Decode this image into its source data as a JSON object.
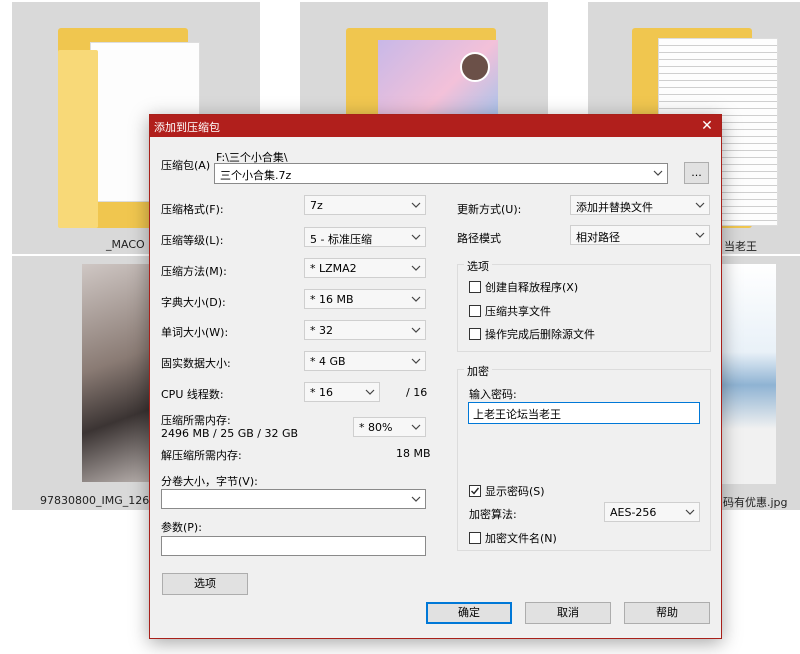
{
  "background": {
    "tiles": [
      {
        "label": "_MACO"
      },
      {
        "label": ""
      },
      {
        "label": "当老王"
      },
      {
        "label": "97830800_IMG_1265"
      },
      {
        "label": "码有优惠.jpg"
      }
    ]
  },
  "dialog": {
    "title": "添加到压缩包",
    "close_glyph": "✕",
    "archive": {
      "label": "压缩包(A)",
      "path": "F:\\三个小合集\\",
      "value": "三个小合集.7z",
      "browse_label": "..."
    },
    "left": {
      "format": {
        "label": "压缩格式(F):",
        "value": "7z"
      },
      "level": {
        "label": "压缩等级(L):",
        "value": "5 - 标准压缩"
      },
      "method": {
        "label": "压缩方法(M):",
        "value": "* LZMA2"
      },
      "dict": {
        "label": "字典大小(D):",
        "value": "* 16 MB"
      },
      "word": {
        "label": "单词大小(W):",
        "value": "* 32"
      },
      "solid": {
        "label": "固实数据大小:",
        "value": "* 4 GB"
      },
      "threads": {
        "label": "CPU 线程数:",
        "value": "* 16",
        "max": "/ 16"
      },
      "mem_compress": {
        "label": "压缩所需内存:",
        "detail": "2496 MB / 25 GB / 32 GB",
        "percent": "* 80%"
      },
      "mem_decompress": {
        "label": "解压缩所需内存:",
        "value": "18 MB"
      },
      "volume": {
        "label": "分卷大小，字节(V):",
        "value": ""
      },
      "params": {
        "label": "参数(P):",
        "value": ""
      },
      "options_button": "选项"
    },
    "right": {
      "update": {
        "label": "更新方式(U):",
        "value": "添加并替换文件"
      },
      "path_mode": {
        "label": "路径模式",
        "value": "相对路径"
      },
      "options_group": {
        "title": "选项",
        "items": [
          {
            "label": "创建自释放程序(X)",
            "checked": false
          },
          {
            "label": "压缩共享文件",
            "checked": false
          },
          {
            "label": "操作完成后删除源文件",
            "checked": false
          }
        ]
      },
      "encrypt_group": {
        "title": "加密",
        "password_label": "输入密码:",
        "password_value": "上老王论坛当老王",
        "show_password": {
          "label": "显示密码(S)",
          "checked": true
        },
        "algorithm": {
          "label": "加密算法:",
          "value": "AES-256"
        },
        "encrypt_names": {
          "label": "加密文件名(N)",
          "checked": false
        }
      }
    },
    "buttons": {
      "ok": "确定",
      "cancel": "取消",
      "help": "帮助"
    }
  },
  "colors": {
    "titlebar": "#b11f1c",
    "focus": "#0078d7",
    "dialog_bg": "#f0f0f0"
  }
}
